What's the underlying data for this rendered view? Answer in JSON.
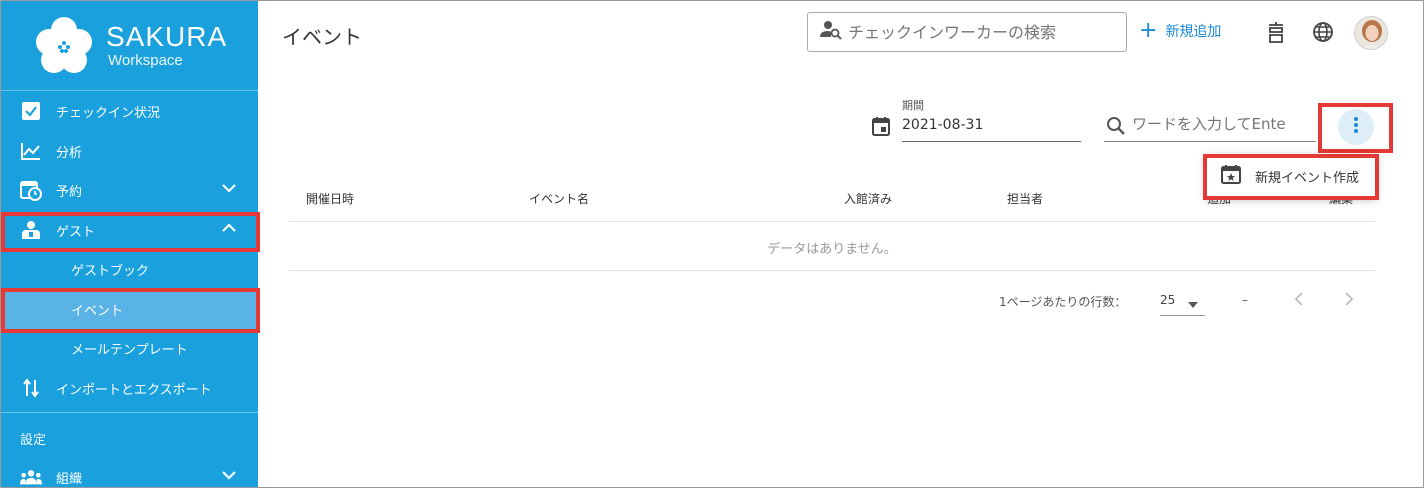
{
  "sidebar": {
    "brand_name": "SAKURA",
    "brand_sub": "Workspace",
    "items": [
      {
        "label": "チェックイン状況",
        "icon": "checkbox-icon"
      },
      {
        "label": "分析",
        "icon": "chart-line-icon"
      },
      {
        "label": "予約",
        "icon": "calendar-clock-icon"
      },
      {
        "label": "ゲスト",
        "icon": "guest-icon"
      }
    ],
    "sub_items": [
      "ゲストブック",
      "イベント",
      "メールテンプレート"
    ],
    "import_export": "インポートとエクスポート",
    "settings_label": "設定",
    "org_label": "組織"
  },
  "header": {
    "title": "イベント",
    "search_placeholder": "チェックインワーカーの検索",
    "add_label": "新規追加"
  },
  "filters": {
    "period_label": "期間",
    "date_value": "2021-08-31",
    "keyword_placeholder": "ワードを入力してEnte"
  },
  "menu": {
    "create_event": "新規イベント作成"
  },
  "table": {
    "headers": [
      "開催日時",
      "イベント名",
      "入館済み",
      "担当者",
      "追加",
      "編集"
    ],
    "empty_text": "データはありません。"
  },
  "pagination": {
    "rows_label": "1ページあたりの行数：",
    "rows_value": "25",
    "range": "–"
  },
  "colors": {
    "sidebar": "#1aa1dd",
    "accent": "#1a88d6",
    "highlight": "#e53935"
  }
}
